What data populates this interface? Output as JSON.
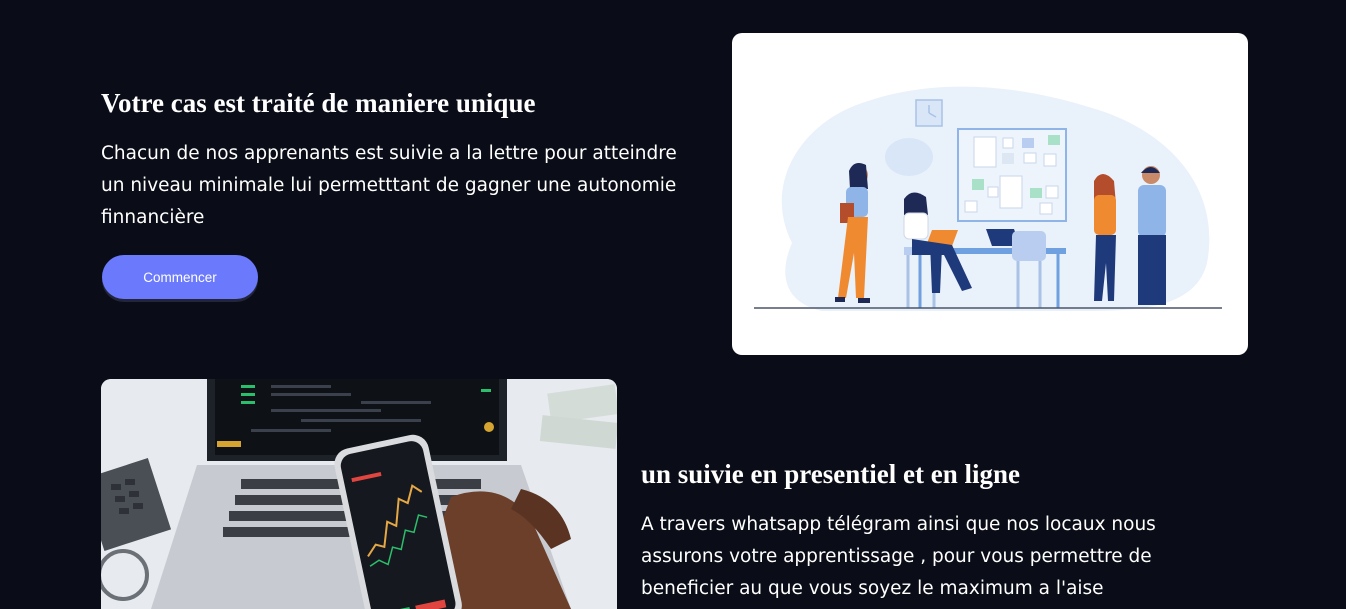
{
  "section1": {
    "title": "Votre cas est traité de maniere unique",
    "body": "Chacun de nos apprenants est suivie a la lettre pour atteindre un niveau minimale lui permetttant de gagner une autonomie finnancière",
    "button_label": "Commencer"
  },
  "section2": {
    "title": "un suivie en presentiel et en ligne",
    "body": "A travers whatsapp télégram ainsi que nos locaux nous assurons votre apprentissage , pour vous permettre de beneficier au que vous soyez le maximum a l'aise"
  },
  "colors": {
    "background": "#0a0d17",
    "button": "#6b7afd",
    "illustration_accent": "#f08a30",
    "illustration_navy": "#1e3a7a"
  },
  "icons": {
    "illustration": "team-meeting-illustration",
    "photo": "trading-phone-photo"
  }
}
